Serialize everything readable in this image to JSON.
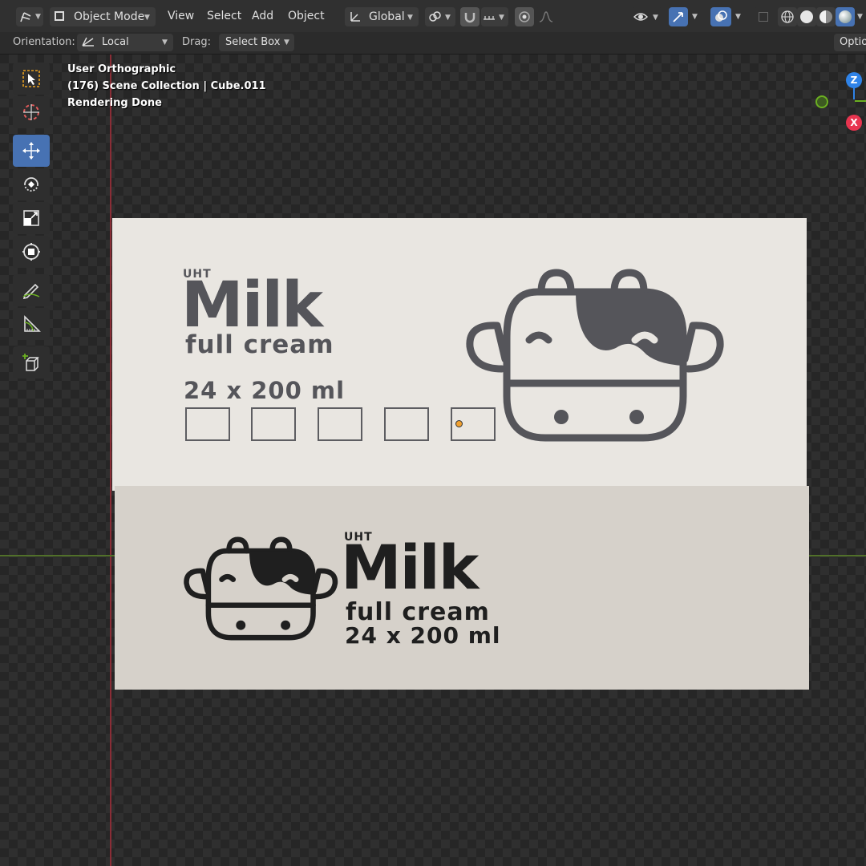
{
  "header": {
    "mode_label": "Object Mode",
    "menus": [
      "View",
      "Select",
      "Add",
      "Object"
    ],
    "transform_orientation": "Global",
    "options_label": "Optio"
  },
  "tool_options": {
    "orientation_label": "Orientation:",
    "orientation_value": "Local",
    "drag_label": "Drag:",
    "drag_value": "Select Box"
  },
  "viewport": {
    "view_name": "User Orthographic",
    "collection_info": "(176) Scene Collection | Cube.011",
    "status": "Rendering Done",
    "gizmo_axes": [
      "Z",
      "X"
    ]
  },
  "toolbar": {
    "tools": [
      {
        "name": "select-box",
        "active": false
      },
      {
        "name": "cursor",
        "active": false
      },
      {
        "name": "move",
        "active": true
      },
      {
        "name": "rotate",
        "active": false
      },
      {
        "name": "scale",
        "active": false
      },
      {
        "name": "transform",
        "active": false
      },
      {
        "name": "annotate",
        "active": false
      },
      {
        "name": "measure",
        "active": false
      },
      {
        "name": "add-cube",
        "active": false
      }
    ]
  },
  "model": {
    "top": {
      "uht": "UHT",
      "brand": "Milk",
      "variant": "full cream",
      "pack": "24 x 200 ml"
    },
    "front": {
      "uht": "UHT",
      "brand": "Milk",
      "variant": "full cream",
      "pack": "24 x 200 ml"
    }
  },
  "colors": {
    "accent": "#4772b3",
    "axis_x": "#e8344f",
    "axis_z": "#2f83e8",
    "axis_y": "#6bb021",
    "box_top": "#e9e6e1",
    "box_front": "#d6d1ca"
  }
}
